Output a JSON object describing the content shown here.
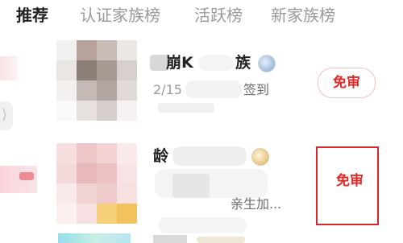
{
  "tabs": [
    {
      "label": "推荐",
      "active": true
    },
    {
      "label": "认证家族榜",
      "active": false
    },
    {
      "label": "活跃榜",
      "active": false
    },
    {
      "label": "新家族榜",
      "active": false
    }
  ],
  "families": [
    {
      "name_fragment": "崩K",
      "name_suffix": "族",
      "info_prefix": "2/15",
      "info_suffix": "签到",
      "badge_icon": "diamond-badge",
      "action_label": "免审"
    },
    {
      "name_fragment": "龄",
      "info_fragment": "亲生加...",
      "badge_icon": "crest-badge",
      "action_label": "免审"
    }
  ],
  "colors": {
    "accent_red": "#e22a2a",
    "highlight_red": "#d9262d",
    "tab_inactive": "#9a9a9a",
    "tab_active": "#222222"
  },
  "edge_handle_glyph": "⟩"
}
